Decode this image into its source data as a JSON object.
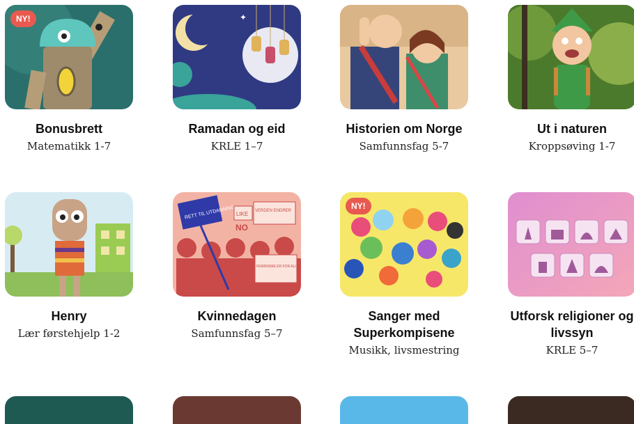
{
  "badge_new": "NY!",
  "cards": [
    {
      "title": "Bonusbrett",
      "subject": "Matematikk 1-7"
    },
    {
      "title": "Ramadan og eid",
      "subject": "KRLE 1–7"
    },
    {
      "title": "Historien om Norge",
      "subject": "Samfunnsfag 5-7"
    },
    {
      "title": "Ut i naturen",
      "subject": "Kroppsøving 1-7"
    },
    {
      "title": "Henry",
      "subject": "Lær førstehjelp 1-2"
    },
    {
      "title": "Kvinnedagen",
      "subject": "Samfunnsfag 5–7"
    },
    {
      "title_line1": "Sanger med",
      "title_line2": "Superkompisene",
      "subject": "Musikk, livsmestring"
    },
    {
      "title_line1": "Utforsk religioner og",
      "title_line2": "livssyn",
      "subject": "KRLE 5–7"
    }
  ],
  "protest_signs": {
    "sign1": "RETT TIL UTDANNING",
    "sign2": "LIKE",
    "sign3": "VERDEN ENDRER",
    "sign4": "NO",
    "sign5": "FEMINISME ER FOR ALLE"
  },
  "colors": {
    "badge": "#e85a4f",
    "bonus_bg": "#2a6f6b",
    "ramadan_bg": "#2f3a82",
    "history_bg": "#e9c9a0",
    "nature_bg": "#4c7a2c",
    "henry_bg": "#d7ecf2",
    "kvinne_bg": "#f3b3a4",
    "sanger_bg": "#f7e769",
    "religion_bg": "#f0a9d4"
  }
}
